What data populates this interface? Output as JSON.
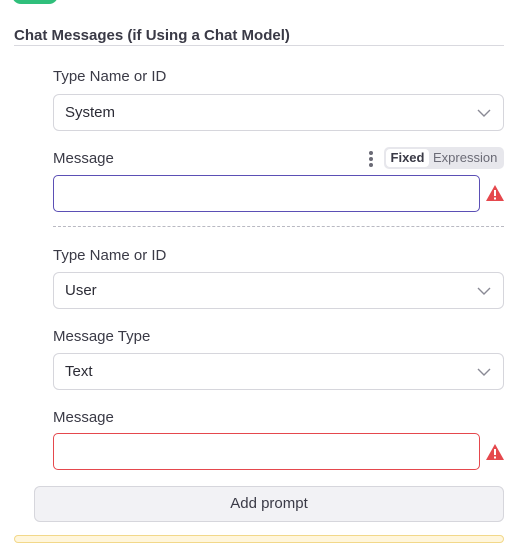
{
  "section": {
    "title": "Chat Messages (if Using a Chat Model)"
  },
  "message1": {
    "type_label": "Type Name or ID",
    "type_value": "System",
    "message_label": "Message",
    "message_value": "",
    "mode_fixed": "Fixed",
    "mode_expression": "Expression"
  },
  "message2": {
    "type_label": "Type Name or ID",
    "type_value": "User",
    "message_type_label": "Message Type",
    "message_type_value": "Text",
    "message_label": "Message",
    "message_value": ""
  },
  "actions": {
    "add_prompt": "Add prompt"
  },
  "icons": {
    "chevron": "chevron-down-icon",
    "warning": "warning-icon",
    "options": "more-vertical-icon"
  },
  "colors": {
    "active_border": "#5b4fb5",
    "error_border": "#e5484d",
    "warning": "#e5484d",
    "toggle_on": "#2fbf7b"
  }
}
